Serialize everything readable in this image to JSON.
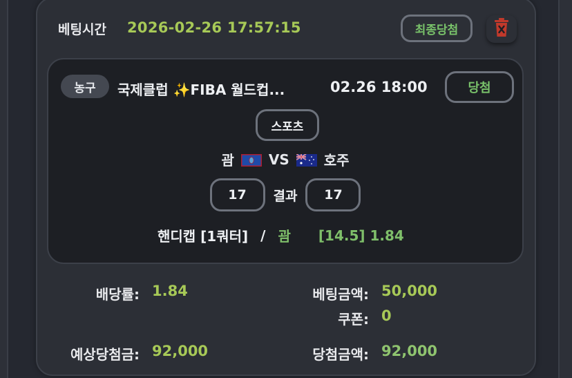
{
  "bet": {
    "time_label": "베팅시간",
    "time_value": "2026-02-26 17:57:15",
    "final_status": "최종당첨",
    "delete_icon": "trash-icon"
  },
  "game": {
    "sport": "농구",
    "league": "국제클럽 ✨FIBA 월드컵...",
    "time": "02.26 18:00",
    "status": "당첨",
    "category": "스포츠",
    "home_team": "괌",
    "vs": "VS",
    "away_team": "호주",
    "home_score": "17",
    "result_label": "결과",
    "away_score": "17",
    "market": "핸디캡 [1쿼터]",
    "separator": "/",
    "pick": "괌",
    "line_odds": "[14.5] 1.84"
  },
  "summary": {
    "odds_label": "배당률:",
    "odds_value": "1.84",
    "bet_amount_label": "베팅금액:",
    "bet_amount_value": "50,000",
    "coupon_label": "쿠폰:",
    "coupon_value": "0",
    "expected_label": "예상당첨금:",
    "expected_value": "92,000",
    "win_amount_label": "당첨금액:",
    "win_amount_value": "92,000"
  },
  "colors": {
    "accent_green": "#a7c957",
    "win_green": "#79c26a",
    "trash_red": "#c0392b"
  }
}
